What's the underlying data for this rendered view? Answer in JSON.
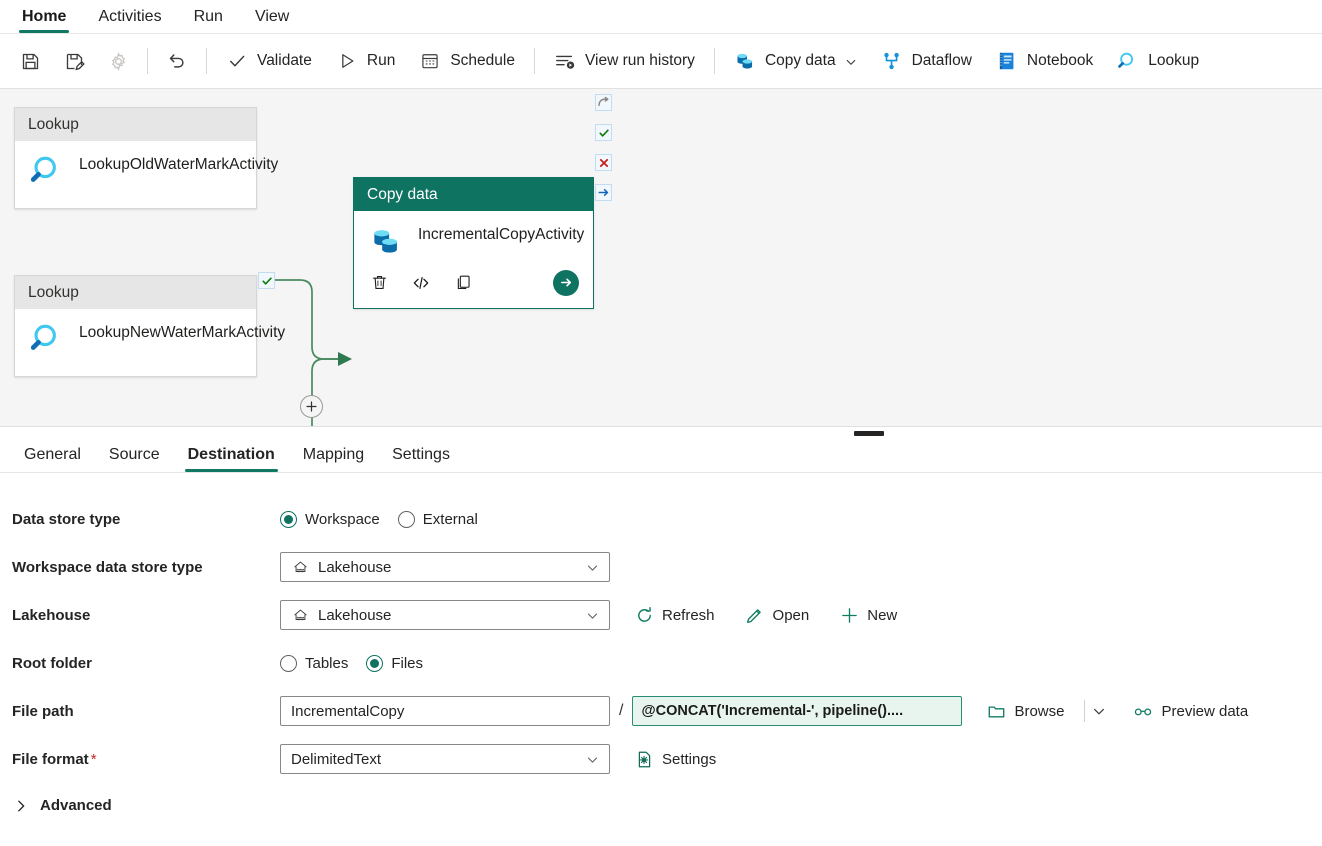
{
  "ribbon": {
    "tabs": [
      {
        "label": "Home",
        "active": true
      },
      {
        "label": "Activities",
        "active": false
      },
      {
        "label": "Run",
        "active": false
      },
      {
        "label": "View",
        "active": false
      }
    ]
  },
  "toolbar": {
    "save": {
      "label": "Save",
      "icon": "save-icon"
    },
    "save_as": {
      "label": "Save as",
      "icon": "save-as-icon"
    },
    "settings": {
      "label": "Settings",
      "icon": "gear-icon"
    },
    "undo": {
      "label": "Undo",
      "icon": "undo-icon"
    },
    "validate": {
      "label": "Validate",
      "icon": "checkmark-icon"
    },
    "run": {
      "label": "Run",
      "icon": "play-icon"
    },
    "schedule": {
      "label": "Schedule",
      "icon": "calendar-icon"
    },
    "view_run_history": {
      "label": "View run history",
      "icon": "run-history-icon"
    },
    "copy_data": {
      "label": "Copy data",
      "icon": "copy-data-icon",
      "has_caret": true
    },
    "dataflow": {
      "label": "Dataflow",
      "icon": "dataflow-icon"
    },
    "notebook": {
      "label": "Notebook",
      "icon": "notebook-icon"
    },
    "lookup": {
      "label": "Lookup",
      "icon": "lookup-magnifier-icon"
    }
  },
  "canvas": {
    "activities": [
      {
        "type_label": "Lookup",
        "name": "LookupOldWaterMarkActivity",
        "icon": "lookup-magnifier-icon",
        "output_status": "success"
      },
      {
        "type_label": "Lookup",
        "name": "LookupNewWaterMarkActivity",
        "icon": "lookup-magnifier-icon",
        "output_status": "success"
      },
      {
        "type_label": "Copy data",
        "name": "IncrementalCopyActivity",
        "icon": "copy-data-icon",
        "selected": true,
        "actions": [
          {
            "name": "delete",
            "icon": "trash-icon"
          },
          {
            "name": "code-view",
            "icon": "code-icon"
          },
          {
            "name": "clone",
            "icon": "copy-icon"
          },
          {
            "name": "run",
            "icon": "arrow-right-circle-icon"
          }
        ],
        "output_statuses": [
          "skipped",
          "success",
          "failure",
          "completion"
        ]
      }
    ],
    "add_activity_button": "+"
  },
  "panel": {
    "tabs": [
      {
        "label": "General",
        "active": false
      },
      {
        "label": "Source",
        "active": false
      },
      {
        "label": "Destination",
        "active": true
      },
      {
        "label": "Mapping",
        "active": false
      },
      {
        "label": "Settings",
        "active": false
      }
    ],
    "fields": {
      "data_store_type": {
        "label": "Data store type",
        "options": [
          {
            "label": "Workspace",
            "selected": true
          },
          {
            "label": "External",
            "selected": false
          }
        ]
      },
      "workspace_data_store_type": {
        "label": "Workspace data store type",
        "value": "Lakehouse",
        "icon": "lakehouse-icon"
      },
      "lakehouse": {
        "label": "Lakehouse",
        "value": "Lakehouse",
        "icon": "lakehouse-icon",
        "actions": [
          {
            "label": "Refresh",
            "icon": "refresh-icon"
          },
          {
            "label": "Open",
            "icon": "pencil-icon"
          },
          {
            "label": "New",
            "icon": "plus-icon"
          }
        ]
      },
      "root_folder": {
        "label": "Root folder",
        "options": [
          {
            "label": "Tables",
            "selected": false
          },
          {
            "label": "Files",
            "selected": true
          }
        ]
      },
      "file_path": {
        "label": "File path",
        "folder_value": "IncrementalCopy",
        "separator": "/",
        "file_value": "@CONCAT('Incremental-', pipeline()....",
        "browse_label": "Browse",
        "preview_label": "Preview data",
        "browse_icon": "folder-icon",
        "browse_caret": "chevron-down-icon",
        "preview_icon": "glasses-icon"
      },
      "file_format": {
        "label": "File format",
        "required_marker": "*",
        "value": "DelimitedText",
        "settings_label": "Settings",
        "settings_icon": "file-settings-icon"
      },
      "advanced": {
        "label": "Advanced",
        "icon": "chevron-right-icon",
        "expanded": false
      }
    }
  }
}
